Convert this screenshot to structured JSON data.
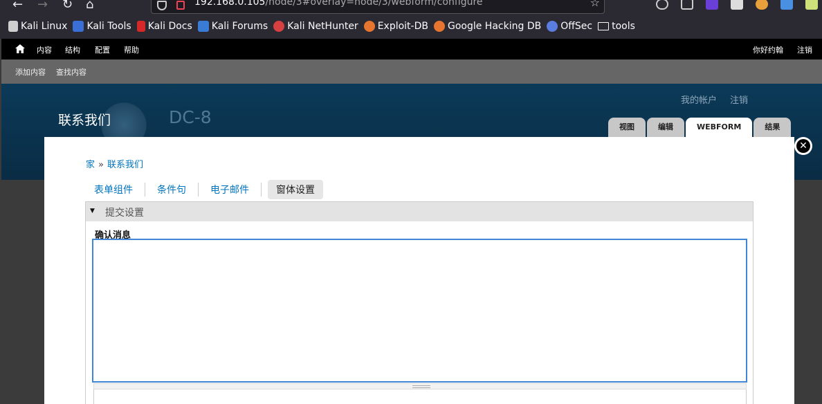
{
  "browser": {
    "url_host": "192.168.0.105",
    "url_path": "/node/3#overlay=node/3/webform/configure",
    "bookmarks": [
      {
        "label": "Kali Linux",
        "color": "#cfcfcf"
      },
      {
        "label": "Kali Tools",
        "color": "#3b6fd8"
      },
      {
        "label": "Kali Docs",
        "color": "#d62828"
      },
      {
        "label": "Kali Forums",
        "color": "#3a7bd5"
      },
      {
        "label": "Kali NetHunter",
        "color": "#d64040"
      },
      {
        "label": "Exploit-DB",
        "color": "#e8752f"
      },
      {
        "label": "Google Hacking DB",
        "color": "#e8752f"
      },
      {
        "label": "OffSec",
        "color": "#5a7de0"
      },
      {
        "label": "tools",
        "color": "#2b2a33"
      }
    ]
  },
  "admin_toolbar": {
    "menu": [
      "内容",
      "结构",
      "配置",
      "帮助"
    ],
    "greeting": "你好约翰",
    "logout": "注销"
  },
  "shortcuts": [
    "添加内容",
    "查找内容"
  ],
  "header": {
    "my_account": "我的帐户",
    "logout": "注销",
    "page_title": "联系我们",
    "site_name": "DC-8",
    "tabs": [
      "视图",
      "编辑",
      "WEBFORM",
      "结果"
    ],
    "active_tab": "WEBFORM"
  },
  "overlay": {
    "breadcrumb": [
      "家",
      "联系我们"
    ],
    "breadcrumb_sep": "»",
    "tabs": [
      "表单组件",
      "条件句",
      "电子邮件",
      "窗体设置"
    ],
    "active_tab": "窗体设置",
    "fieldset_title": "提交设置",
    "field_label": "确认消息",
    "field_value": ""
  },
  "colors": {
    "link": "#0074bd",
    "focus_border": "#3f86d6",
    "header_bg": "#0b3a58"
  }
}
